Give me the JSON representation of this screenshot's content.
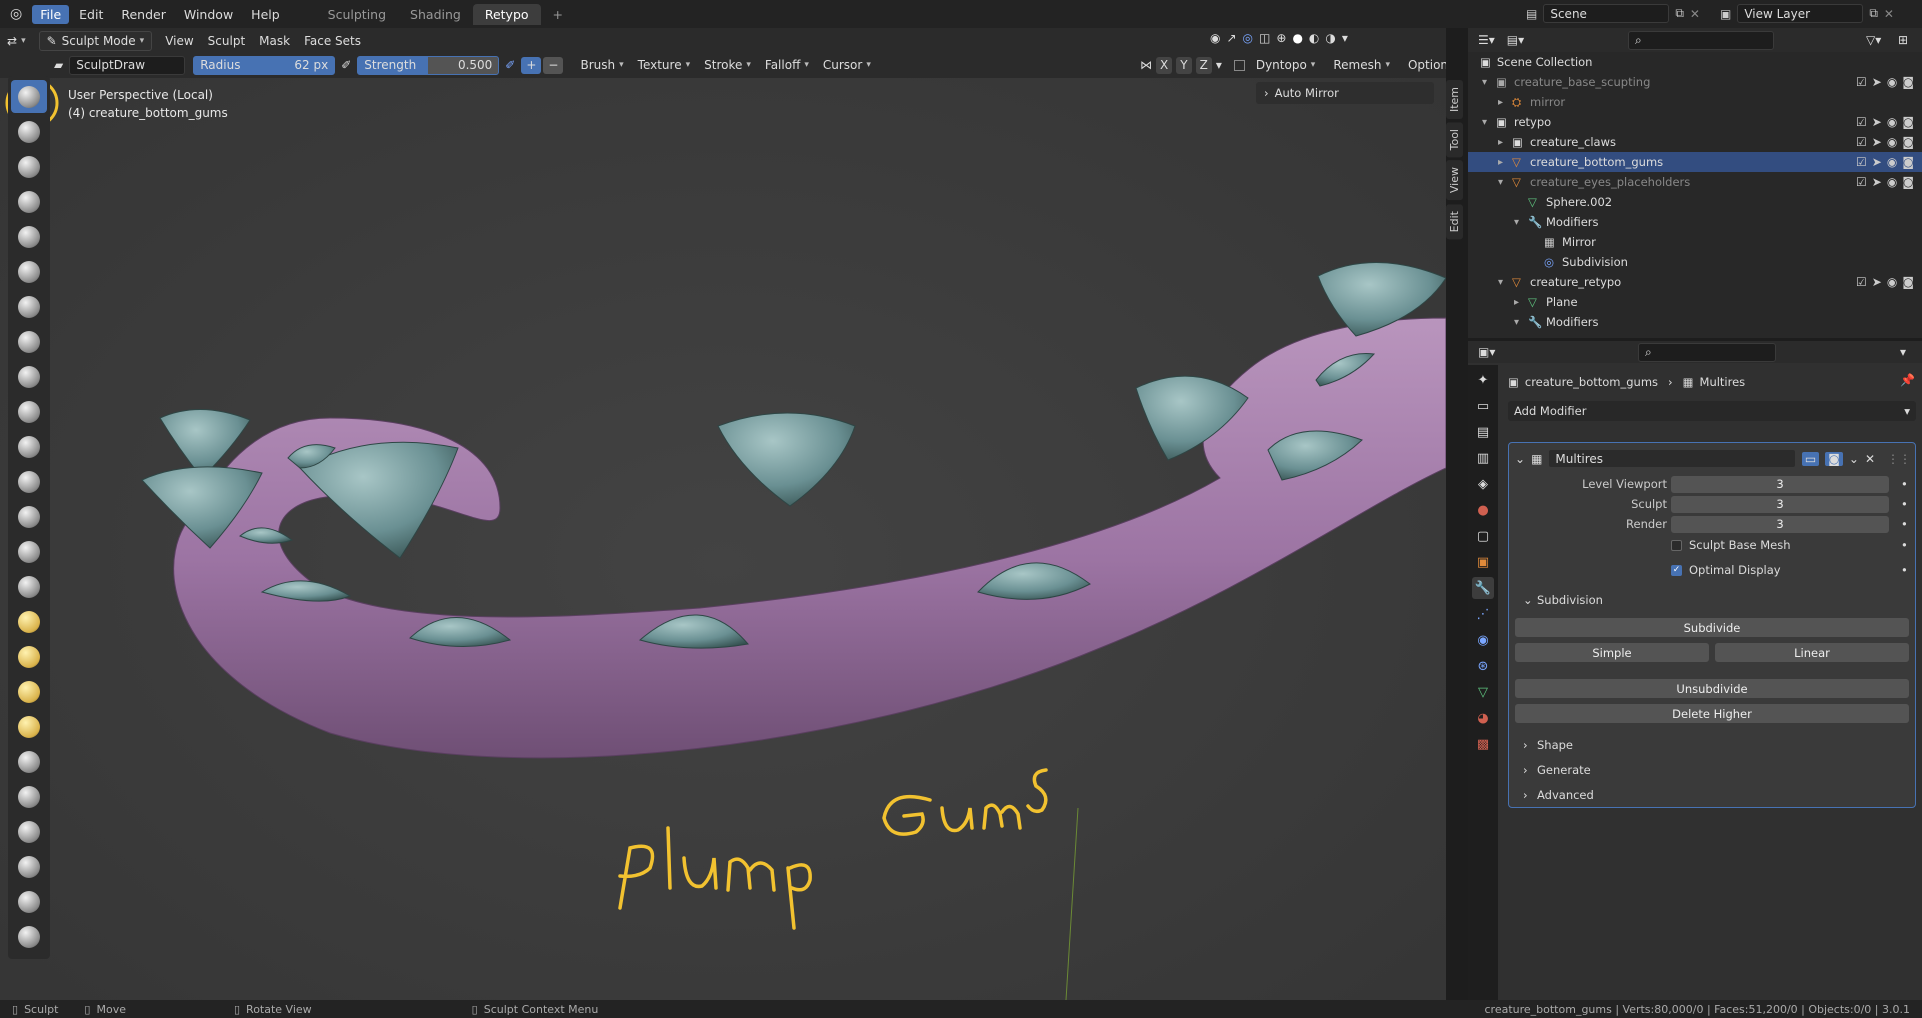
{
  "topbar": {
    "menus": [
      "File",
      "Edit",
      "Render",
      "Window",
      "Help"
    ],
    "workspace_tabs": [
      "Sculpting",
      "Shading",
      "Retypo"
    ],
    "add_tab": "+",
    "scene": "Scene",
    "view_layer": "View Layer"
  },
  "header": {
    "mode": "Sculpt Mode",
    "menus": [
      "View",
      "Sculpt",
      "Mask",
      "Face Sets"
    ]
  },
  "tool_header": {
    "brush_name": "SculptDraw",
    "radius_label": "Radius",
    "radius_value": "62 px",
    "strength_label": "Strength",
    "strength_value": "0.500",
    "plus": "+",
    "minus": "−",
    "menus": [
      "Brush",
      "Texture",
      "Stroke",
      "Falloff",
      "Cursor"
    ],
    "axes": [
      "X",
      "Y",
      "Z"
    ],
    "right_menus": [
      "Dyntopo",
      "Remesh",
      "Options"
    ]
  },
  "viewport": {
    "perspective_label": "User Perspective (Local)",
    "object_label": "(4) creature_bottom_gums",
    "auto_mirror": "Auto Mirror",
    "annotation": "Plump Gums",
    "side_tabs": [
      "Item",
      "Tool",
      "View",
      "Edit"
    ]
  },
  "outliner": {
    "root": "Scene Collection",
    "rows": [
      {
        "label": "creature_base_scupting",
        "dim": true
      },
      {
        "label": "mirror",
        "dim": true
      },
      {
        "label": "retypo",
        "dim": false
      },
      {
        "label": "creature_claws",
        "dim": false
      },
      {
        "label": "creature_bottom_gums",
        "dim": false
      },
      {
        "label": "creature_eyes_placeholders",
        "dim": true
      },
      {
        "label": "Sphere.002",
        "dim": false
      },
      {
        "label": "Modifiers",
        "dim": false
      },
      {
        "label": "Mirror",
        "dim": false
      },
      {
        "label": "Subdivision",
        "dim": false
      },
      {
        "label": "creature_retypo",
        "dim": false
      },
      {
        "label": "Plane",
        "dim": false
      },
      {
        "label": "Modifiers",
        "dim": false
      }
    ]
  },
  "properties": {
    "breadcrumb_object": "creature_bottom_gums",
    "breadcrumb_modifier": "Multires",
    "add_modifier": "Add Modifier",
    "modifier_name": "Multires",
    "fields": [
      {
        "label": "Level Viewport",
        "value": "3"
      },
      {
        "label": "Sculpt",
        "value": "3"
      },
      {
        "label": "Render",
        "value": "3"
      }
    ],
    "sculpt_base_mesh": "Sculpt Base Mesh",
    "optimal_display": "Optimal Display",
    "optimal_checked": true,
    "subdivision_header": "Subdivision",
    "subdivide": "Subdivide",
    "simple": "Simple",
    "linear": "Linear",
    "unsubdivide": "Unsubdivide",
    "delete_higher": "Delete Higher",
    "sections": [
      "Shape",
      "Generate",
      "Advanced"
    ]
  },
  "statusbar": {
    "sculpt": "Sculpt",
    "move": "Move",
    "rotate_view": "Rotate View",
    "context_menu": "Sculpt Context Menu",
    "stats": "creature_bottom_gums | Verts:80,000/0 | Faces:51,200/0 | Objects:0/0 | 3.0.1"
  },
  "colors": {
    "accent": "#4772b3",
    "gum": "#a07aa6",
    "tooth": "#6d9396",
    "annotation": "#f2c230"
  }
}
